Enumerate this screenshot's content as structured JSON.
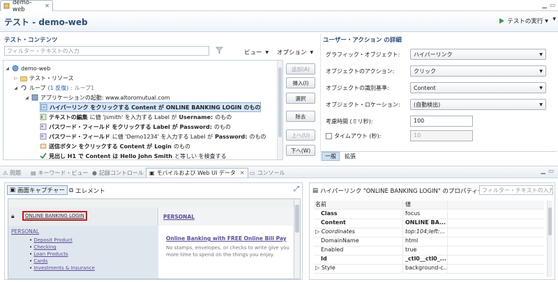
{
  "editor_tab": {
    "label": "demo-web"
  },
  "header": {
    "title": "テスト - demo-web",
    "run_label": "テストの実行"
  },
  "test_contents": {
    "title": "テスト・コンテンツ",
    "filter_placeholder": "フィルター・テキストの入力",
    "view_label": "ビュー",
    "options_label": "オプション",
    "tree": {
      "root": "demo-web",
      "resources": "テスト・リソース",
      "loop_label": "ループ",
      "loop_iter": "(1 反復)",
      "loop_suffix": ": ループ1",
      "app_start": "アプリケーションの起動: www.altoromutual.com",
      "step1_a": "ハイパーリンク をクリックする Content が",
      "step1_b": "ONLINE BANKING LOGIN",
      "step1_c": "のもの",
      "step2_a": "テキストの編集",
      "step2_b": "に値 'jsmith' を入力する Label が",
      "step2_c": "Username:",
      "step2_d": "のもの",
      "step3_a": "パスワード・フィールド をクリックする Label が",
      "step3_b": "Password:",
      "step3_c": "のもの",
      "step4_a": "パスワード・フィールド",
      "step4_b": "に値 'Demo1234' を入力する Label が",
      "step4_c": "Password:",
      "step4_d": "のもの",
      "step5_a": "送信ボタン をクリックする Content が",
      "step5_b": "Login",
      "step5_c": "のもの",
      "step6_a": "見出し H1 で Content は",
      "step6_b": "Hello John Smith",
      "step6_c": "と等しい を検査する"
    },
    "buttons": {
      "add": "追加(A)",
      "insert": "挿入(I)",
      "select": "選択",
      "remove": "除去",
      "up": "上へ(U)",
      "down": "下へ(W)"
    }
  },
  "user_action": {
    "title": "ユーザー・アクション の詳細",
    "graphic_object_label": "グラフィック・オブジェクト:",
    "graphic_object_value": "ハイパーリンク",
    "object_action_label": "オブジェクトのアクション:",
    "object_action_value": "クリック",
    "identify_label": "オブジェクトの識別基準:",
    "identify_value": "Content",
    "location_label": "オブジェクト・ロケーション:",
    "location_value": "(自動検出)",
    "think_time_label": "考慮時間 (ミリ秒):",
    "think_time_value": "100",
    "timeout_label": "タイムアウト (秒):",
    "timeout_value": "10",
    "tab_general": "一般",
    "tab_extension": "拡張"
  },
  "bottom_tabs": {
    "problems": "問題",
    "keyword_view": "キーワード・ビュー",
    "record_control": "記録コントロール",
    "mobile_web": "モバイルおよび Web UI データ",
    "console": "コンソール"
  },
  "capture": {
    "screen_capture": "画面キャプチャー",
    "element": "エレメント",
    "online_banking_login": "ONLINE BANKING LOGIN",
    "personal_tab": "PERSONAL",
    "personal": "PERSONAL",
    "links": [
      "Deposit Product",
      "Checking",
      "Loan Products",
      "Cards",
      "Investments & Insurance"
    ],
    "promo_title": "Online Banking with FREE Online Bill Pay",
    "promo_text_1": "No stamps, envelopes, or checks to write give you",
    "promo_text_2": "more time to spend on the things you enjoy."
  },
  "properties": {
    "title": "ハイパーリンク \"ONLINE BANKING LOGIN\" のプロパティー",
    "filter_placeholder": "フィルター・テキストの入力",
    "col_name": "名前",
    "col_value": "値",
    "rows": [
      {
        "name": "Class",
        "value": "focus"
      },
      {
        "name": "Content",
        "value": "ONLINE BA..."
      },
      {
        "name": "Coordinates",
        "value": "top:104;left:..."
      },
      {
        "name": "DomainName",
        "value": "html"
      },
      {
        "name": "Enabled",
        "value": "true"
      },
      {
        "name": "Id",
        "value": "_ctl0__ctl0_..."
      },
      {
        "name": "Style",
        "value": "background-c..."
      }
    ]
  }
}
